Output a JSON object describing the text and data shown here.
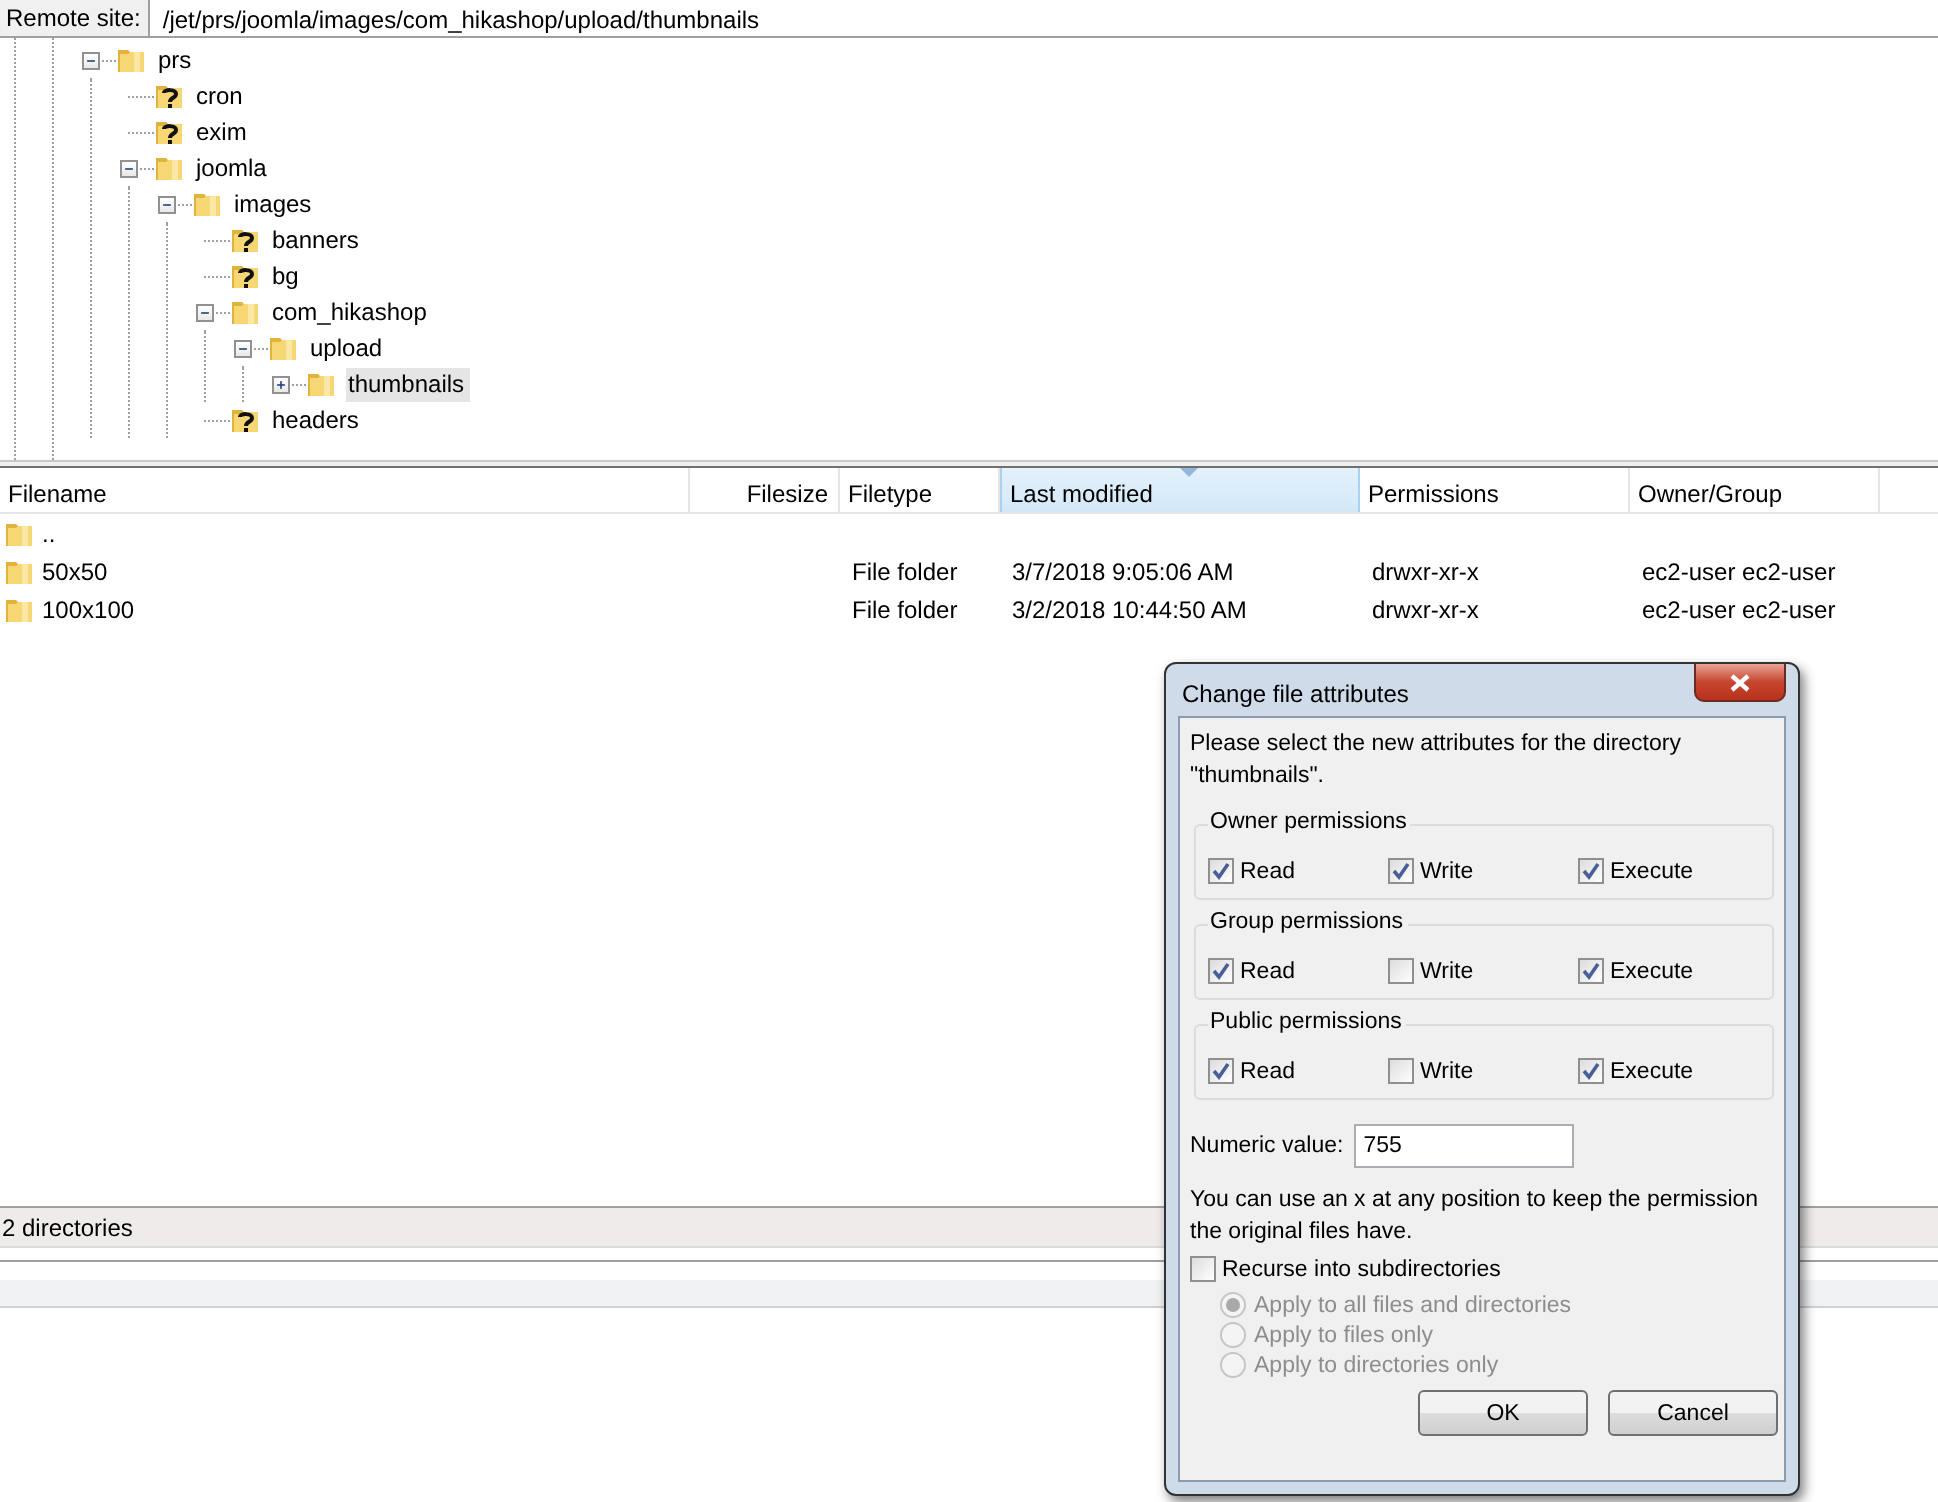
{
  "remote_site": {
    "label": "Remote site:",
    "path": "/jet/prs/joomla/images/com_hikashop/upload/thumbnails"
  },
  "tree": [
    {
      "name": "prs",
      "kind": "folder",
      "expanded": true,
      "selected": false,
      "children": [
        {
          "name": "cron",
          "kind": "unknown",
          "selected": false
        },
        {
          "name": "exim",
          "kind": "unknown",
          "selected": false
        },
        {
          "name": "joomla",
          "kind": "folder",
          "expanded": true,
          "selected": false,
          "children": [
            {
              "name": "images",
              "kind": "folder",
              "expanded": true,
              "selected": false,
              "children": [
                {
                  "name": "banners",
                  "kind": "unknown",
                  "selected": false
                },
                {
                  "name": "bg",
                  "kind": "unknown",
                  "selected": false
                },
                {
                  "name": "com_hikashop",
                  "kind": "folder",
                  "expanded": true,
                  "selected": false,
                  "children": [
                    {
                      "name": "upload",
                      "kind": "folder",
                      "expanded": true,
                      "selected": false,
                      "children": [
                        {
                          "name": "thumbnails",
                          "kind": "folder",
                          "expanded": false,
                          "selected": true
                        }
                      ]
                    }
                  ]
                },
                {
                  "name": "headers",
                  "kind": "unknown",
                  "selected": false
                }
              ]
            }
          ]
        }
      ]
    }
  ],
  "file_list": {
    "columns": [
      {
        "label": "Filename",
        "sorted": false
      },
      {
        "label": "Filesize",
        "sorted": false
      },
      {
        "label": "Filetype",
        "sorted": false
      },
      {
        "label": "Last modified",
        "sorted": true
      },
      {
        "label": "Permissions",
        "sorted": false
      },
      {
        "label": "Owner/Group",
        "sorted": false
      }
    ],
    "rows": [
      {
        "filename": ".."
      },
      {
        "filename": "50x50",
        "filetype": "File folder",
        "modified": "3/7/2018 9:05:06 AM",
        "permissions": "drwxr-xr-x",
        "owner": "ec2-user ec2-user"
      },
      {
        "filename": "100x100",
        "filetype": "File folder",
        "modified": "3/2/2018 10:44:50 AM",
        "permissions": "drwxr-xr-x",
        "owner": "ec2-user ec2-user"
      }
    ]
  },
  "status_bar": "2 directories",
  "dialog": {
    "title": "Change file attributes",
    "message": "Please select the new attributes for the directory \"thumbnails\".",
    "groups": [
      {
        "title": "Owner permissions",
        "options": [
          {
            "label": "Read",
            "checked": true
          },
          {
            "label": "Write",
            "checked": true
          },
          {
            "label": "Execute",
            "checked": true
          }
        ]
      },
      {
        "title": "Group permissions",
        "options": [
          {
            "label": "Read",
            "checked": true
          },
          {
            "label": "Write",
            "checked": false
          },
          {
            "label": "Execute",
            "checked": true
          }
        ]
      },
      {
        "title": "Public permissions",
        "options": [
          {
            "label": "Read",
            "checked": true
          },
          {
            "label": "Write",
            "checked": false
          },
          {
            "label": "Execute",
            "checked": true
          }
        ]
      }
    ],
    "numeric": {
      "label": "Numeric value:",
      "value": "755"
    },
    "hint": "You can use an x at any position to keep the permission the original files have.",
    "recurse": {
      "label": "Recurse into subdirectories",
      "checked": false
    },
    "apply_options": [
      {
        "label": "Apply to all files and directories",
        "selected": true,
        "disabled": true
      },
      {
        "label": "Apply to files only",
        "selected": false,
        "disabled": true
      },
      {
        "label": "Apply to directories only",
        "selected": false,
        "disabled": true
      }
    ],
    "buttons": [
      "OK",
      "Cancel"
    ]
  }
}
